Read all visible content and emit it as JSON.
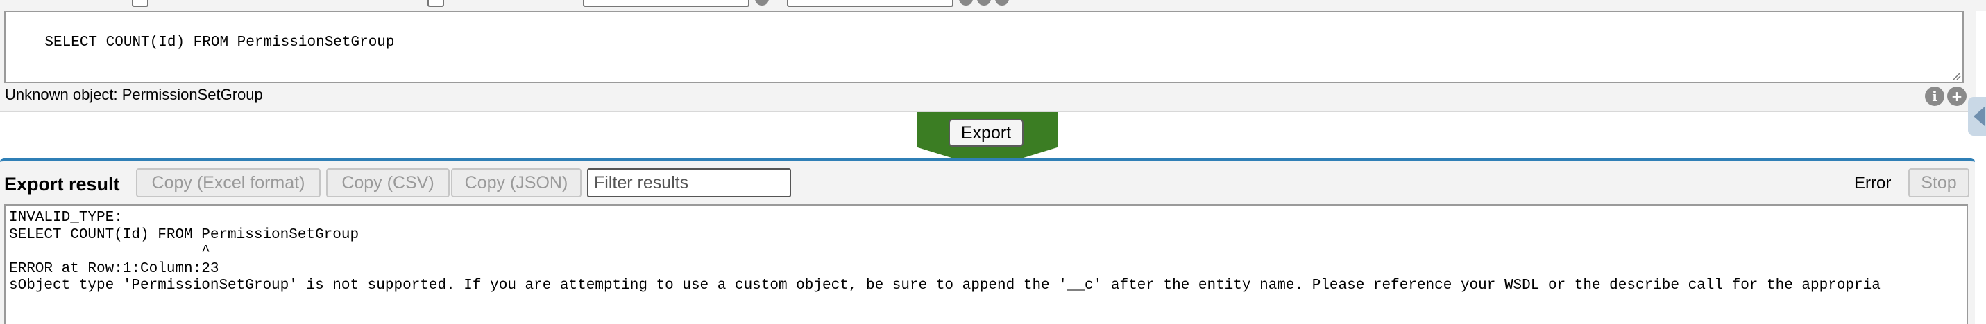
{
  "query": {
    "text": "SELECT COUNT(Id) FROM PermissionSetGroup",
    "status": "Unknown object: PermissionSetGroup",
    "info_icon_glyph": "i",
    "add_icon_glyph": "+"
  },
  "export": {
    "button_label": "Export",
    "accent_color": "#3b7d23"
  },
  "result": {
    "title": "Export result",
    "buttons": {
      "copy_excel": "Copy (Excel format)",
      "copy_csv": "Copy (CSV)",
      "copy_json": "Copy (JSON)"
    },
    "filter_placeholder": "Filter results",
    "status": "Error",
    "stop_label": "Stop",
    "output": "INVALID_TYPE:\nSELECT COUNT(Id) FROM PermissionSetGroup\n                      ^\nERROR at Row:1:Column:23\nsObject type 'PermissionSetGroup' is not supported. If you are attempting to use a custom object, be sure to append the '__c' after the entity name. Please reference your WSDL or the describe call for the appropria",
    "border_color": "#2f7fb6"
  }
}
